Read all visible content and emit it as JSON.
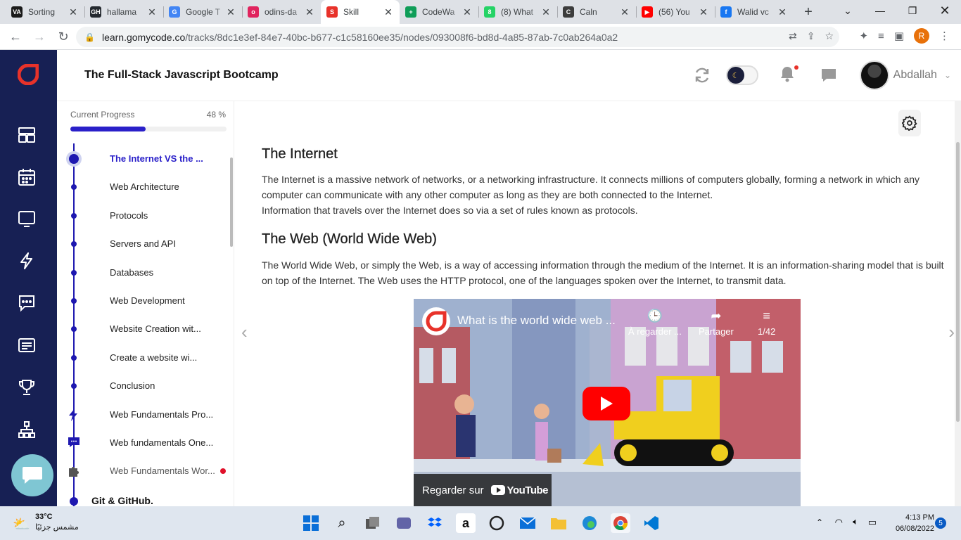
{
  "browser": {
    "tabs": [
      {
        "title": "Sorting",
        "favicon": "VA",
        "color": "#1a1a1a"
      },
      {
        "title": "hallama",
        "favicon": "GH",
        "color": "#24292f"
      },
      {
        "title": "Google T",
        "favicon": "G",
        "color": "#4285f4"
      },
      {
        "title": "odins-da",
        "favicon": "o",
        "color": "#e0245e"
      },
      {
        "title": "Skill",
        "favicon": "S",
        "color": "#e8322a",
        "active": true
      },
      {
        "title": "CodeWa",
        "favicon": "+",
        "color": "#0f9d58"
      },
      {
        "title": "(8) What",
        "favicon": "8",
        "color": "#25d366"
      },
      {
        "title": "Caln",
        "favicon": "C",
        "color": "#3c3c3c"
      },
      {
        "title": "(56) You",
        "favicon": "▶",
        "color": "#ff0000"
      },
      {
        "title": "Walid vc",
        "favicon": "f",
        "color": "#1877f2"
      }
    ],
    "url_host": "learn.gomycode.co",
    "url_path": "/tracks/8dc1e3ef-84e7-40bc-b677-c1c58160ee35/nodes/093008f6-bd8d-4a85-87ab-7c0ab264a0a2",
    "profile_initial": "R"
  },
  "app": {
    "course_title": "The Full-Stack Javascript Bootcamp",
    "user_name": "Abdallah",
    "brand_color": "#e8322a",
    "accent_color": "#2a20c9"
  },
  "progress": {
    "label": "Current Progress",
    "percent_text": "48 %",
    "value": 0.48
  },
  "lessons": [
    {
      "label": "The Internet VS the ...",
      "state": "current"
    },
    {
      "label": "Web Architecture"
    },
    {
      "label": "Protocols"
    },
    {
      "label": "Servers and API"
    },
    {
      "label": "Databases"
    },
    {
      "label": "Web Development"
    },
    {
      "label": "Website Creation wit..."
    },
    {
      "label": "Create a website wi..."
    },
    {
      "label": "Conclusion"
    },
    {
      "label": "Web Fundamentals Pro...",
      "icon": "lightning-icon"
    },
    {
      "label": "Web fundamentals One...",
      "icon": "chat-icon"
    },
    {
      "label": "Web Fundamentals Wor...",
      "icon": "puzzle-icon",
      "dim": true,
      "badge": true
    }
  ],
  "next_section": "Git & GitHub.",
  "content": {
    "h1": "The Internet",
    "p1": "The Internet is a massive network of networks, or a networking infrastructure. It connects millions of computers globally, forming a network in which any computer can communicate with any other computer as long as they are both connected to the Internet.",
    "p2": "Information that travels over the Internet does so via a set of rules known as protocols.",
    "h2": "The Web (World Wide Web)",
    "p3": "The World Wide Web, or simply the Web, is a way of accessing information through the medium of the Internet. It is an information-sharing model that is built on top of the Internet. The Web uses the HTTP protocol, one of the languages spoken over the Internet, to transmit data.",
    "video": {
      "title": "What is the world wide web ...",
      "watch_later": "À regarder ...",
      "share": "Partager",
      "playlist": "1/42",
      "watch_on": "Regarder sur",
      "yt_brand": "YouTube"
    }
  },
  "taskbar": {
    "temp": "33°C",
    "weather_desc": "مشمس جزئيًا",
    "time": "4:13 PM",
    "date": "06/08/2022",
    "notifications": "5"
  }
}
